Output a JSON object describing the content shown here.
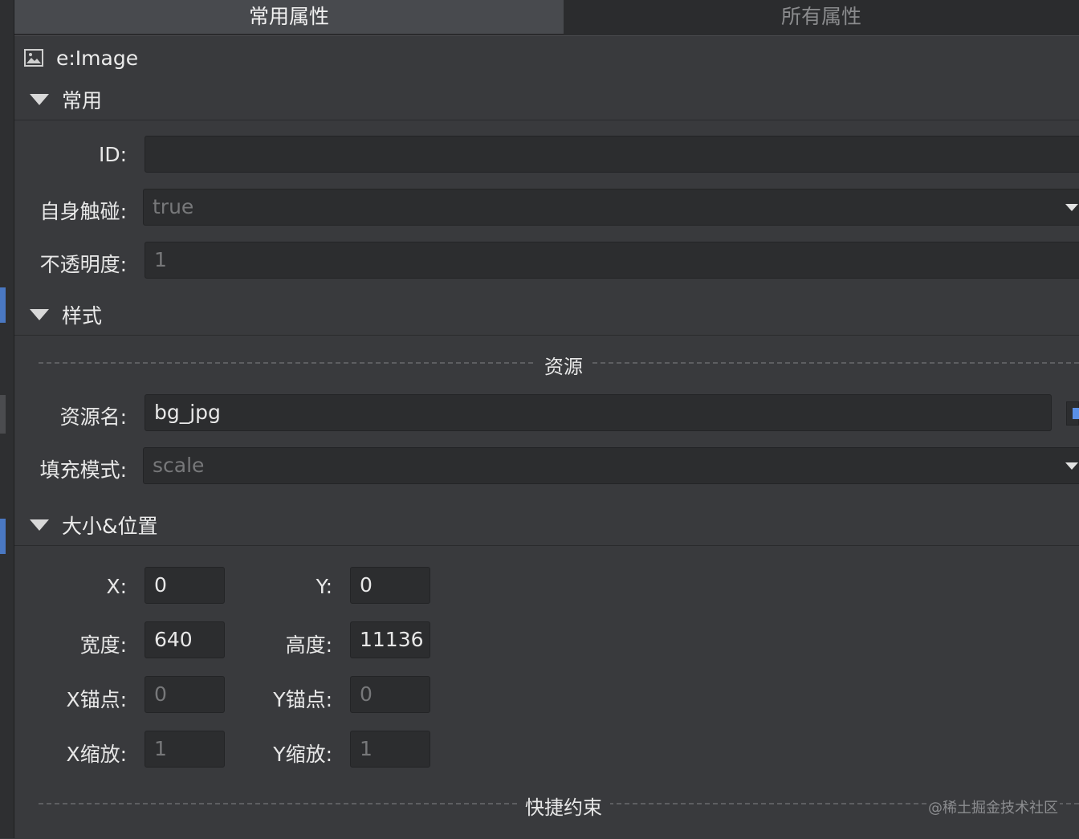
{
  "tabs": {
    "common": "常用属性",
    "all": "所有属性"
  },
  "component": {
    "title": "e:Image",
    "icon": "image-icon"
  },
  "sections": {
    "common": {
      "title": "常用"
    },
    "style": {
      "title": "样式"
    },
    "size_position": {
      "title": "大小&位置"
    }
  },
  "fields": {
    "id": {
      "label": "ID:",
      "value": ""
    },
    "touch_enabled": {
      "label": "自身触碰:",
      "value": "true"
    },
    "alpha": {
      "label": "不透明度:",
      "value": "1"
    },
    "source": {
      "label": "资源名:",
      "value": "bg_jpg"
    },
    "fill_mode": {
      "label": "填充模式:",
      "value": "scale"
    },
    "x": {
      "label": "X:",
      "value": "0"
    },
    "y": {
      "label": "Y:",
      "value": "0"
    },
    "width": {
      "label": "宽度:",
      "value": "640"
    },
    "height": {
      "label": "高度:",
      "value": "11136"
    },
    "anchor_x": {
      "label": "X锚点:",
      "value": "0"
    },
    "anchor_y": {
      "label": "Y锚点:",
      "value": "0"
    },
    "scale_x": {
      "label": "X缩放:",
      "value": "1"
    },
    "scale_y": {
      "label": "Y缩放:",
      "value": "1"
    }
  },
  "dividers": {
    "resource": "资源",
    "constraints": "快捷约束"
  },
  "watermark": "@稀土掘金技术社区",
  "colors": {
    "accent": "#5a8fe6",
    "panel_bg": "#393a3d",
    "field_bg": "#2c2d2f"
  }
}
